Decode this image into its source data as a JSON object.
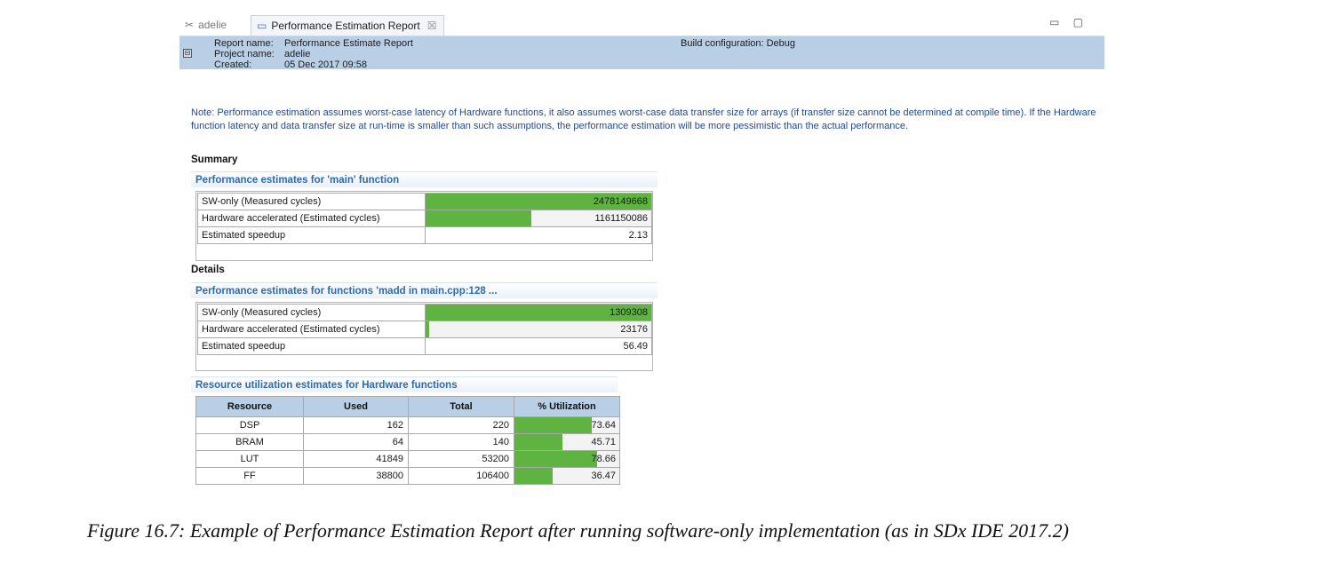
{
  "tabs": {
    "inactive": "adelie",
    "active": "Performance Estimation Report",
    "close": "☒"
  },
  "window_controls": "▭ ▢",
  "header": {
    "collapse": "⊟",
    "report_name_label": "Report name:",
    "report_name": "Performance Estimate Report",
    "project_name_label": "Project name:",
    "project_name": "adelie",
    "created_label": "Created:",
    "created": "05 Dec 2017 09:58",
    "build_config": "Build configuration:  Debug"
  },
  "note": "Note: Performance estimation assumes worst-case latency of Hardware functions, it also assumes worst-case data transfer size for arrays (if transfer size cannot be determined at compile time). If the Hardware function latency and data transfer size at run-time is smaller than such assumptions, the performance estimation will be more pessimistic than the actual performance.",
  "summary": {
    "title": "Summary",
    "section": "Performance estimates for 'main' function",
    "rows": [
      {
        "label": "SW-only (Measured cycles)",
        "value": "2478149668",
        "fill": 1.0
      },
      {
        "label": "Hardware accelerated (Estimated cycles)",
        "value": "1161150086",
        "fill": 0.4685
      },
      {
        "label": "Estimated speedup",
        "value": "2.13",
        "fill": 0
      }
    ]
  },
  "details": {
    "title": "Details",
    "section": "Performance estimates for functions 'madd in main.cpp:128 ...",
    "rows": [
      {
        "label": "SW-only (Measured cycles)",
        "value": "1309308",
        "fill": 1.0
      },
      {
        "label": "Hardware accelerated (Estimated cycles)",
        "value": "23176",
        "fill": 0.0177
      },
      {
        "label": "Estimated speedup",
        "value": "56.49",
        "fill": 0
      }
    ]
  },
  "resources": {
    "section": "Resource utilization estimates for Hardware functions",
    "headers": [
      "Resource",
      "Used",
      "Total",
      "% Utilization"
    ],
    "rows": [
      {
        "resource": "DSP",
        "used": "162",
        "total": "220",
        "util": "73.64",
        "fill": 0.7364
      },
      {
        "resource": "BRAM",
        "used": "64",
        "total": "140",
        "util": "45.71",
        "fill": 0.4571
      },
      {
        "resource": "LUT",
        "used": "41849",
        "total": "53200",
        "util": "78.66",
        "fill": 0.7866
      },
      {
        "resource": "FF",
        "used": "38800",
        "total": "106400",
        "util": "36.47",
        "fill": 0.3647
      }
    ]
  },
  "caption": "Figure 16.7:  Example of Performance Estimation Report after running software-only implementation (as in SDx IDE 2017.2)",
  "colors": {
    "header_bg": "#b8cfe6",
    "bar_fill": "#5fb340",
    "section_text": "#2d6bb0",
    "note_text": "#1f4a8f"
  }
}
